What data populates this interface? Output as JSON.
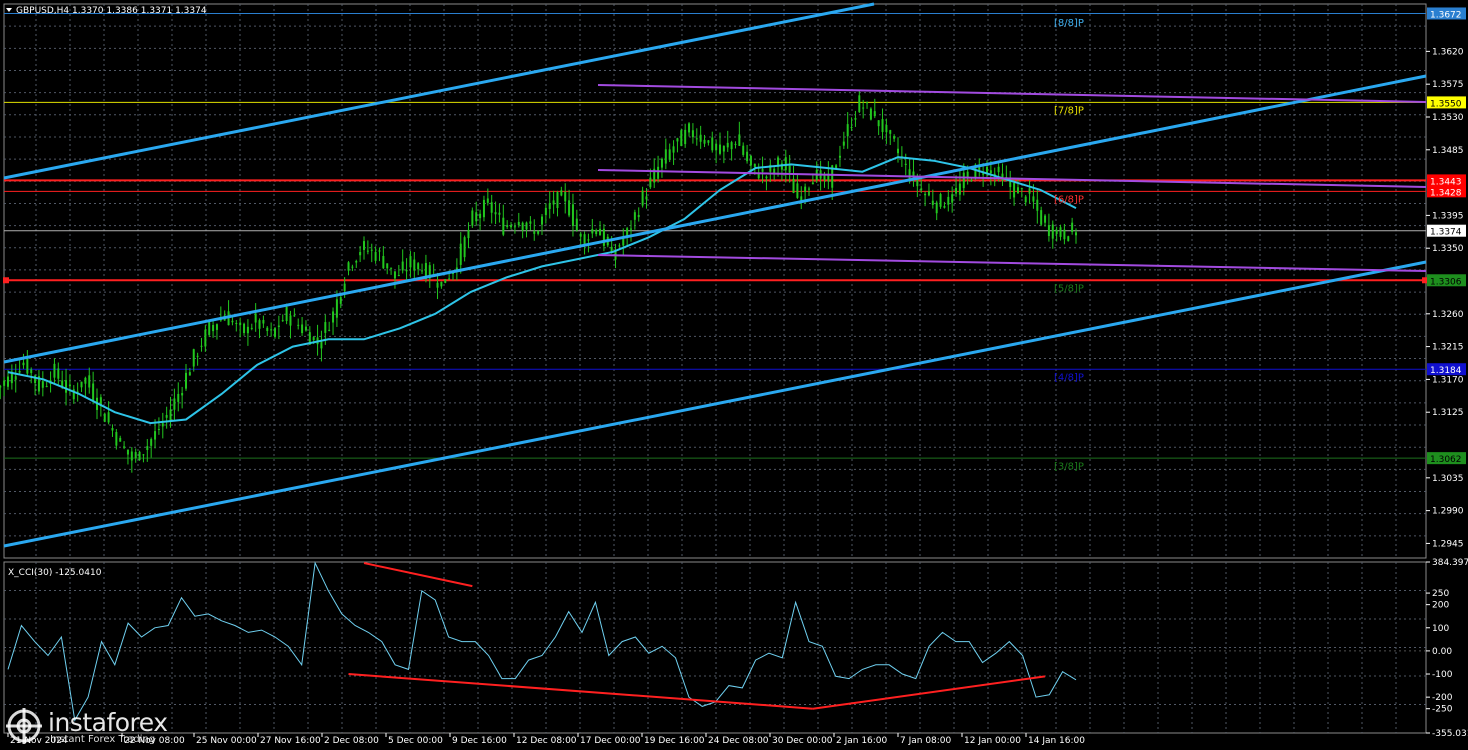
{
  "header": {
    "symbol_line": "GBPUSD,H4  1.3370 1.3386 1.3371 1.3374"
  },
  "indicator": {
    "label": "X_CCI(30) -125.0410"
  },
  "brand": {
    "name": "instaforex",
    "tagline": "Instant Forex Trading"
  },
  "colors": {
    "background": "#000000",
    "grid": "#5a6270",
    "candles": "#22c71f",
    "moving_average": "#2ec4e8",
    "channel": "#2aa8f0",
    "linreg": "#a24be0",
    "support_resistance": "#ff2020",
    "cci_line": "#6fd0f0",
    "divergence": "#ff2020",
    "axis_text": "#ffffff"
  },
  "chart_data": {
    "type": "candlestick",
    "price_axis": {
      "range": [
        1.2925,
        1.3685
      ],
      "ticks": [
        "1.3620",
        "1.3575",
        "1.3530",
        "1.3485",
        "1.3395",
        "1.3350",
        "1.3260",
        "1.3215",
        "1.3170",
        "1.3125",
        "1.3035",
        "1.2990",
        "1.2945"
      ]
    },
    "price_labels": [
      {
        "text": "1.3672",
        "value": 1.3672,
        "bg": "#2a7fd0",
        "fg": "#ffffff"
      },
      {
        "text": "1.3550",
        "value": 1.355,
        "bg": "#ffff00",
        "fg": "#000000"
      },
      {
        "text": "1.3443",
        "value": 1.3443,
        "bg": "#ff0000",
        "fg": "#ffffff"
      },
      {
        "text": "1.3428",
        "value": 1.3428,
        "bg": "#ff0000",
        "fg": "#ffffff"
      },
      {
        "text": "1.3374",
        "value": 1.3374,
        "bg": "#ffffff",
        "fg": "#000000"
      },
      {
        "text": "1.3306",
        "value": 1.3306,
        "bg": "#1e8f1e",
        "fg": "#000000"
      },
      {
        "text": "1.3184",
        "value": 1.3184,
        "bg": "#1010d0",
        "fg": "#ffffff"
      },
      {
        "text": "1.3062",
        "value": 1.3062,
        "bg": "#1e8f1e",
        "fg": "#000000"
      }
    ],
    "horizontal_lines": [
      {
        "value": 1.3672,
        "color": "#2a7fd0",
        "width": 1
      },
      {
        "value": 1.355,
        "color": "#e0e000",
        "width": 1
      },
      {
        "value": 1.3443,
        "color": "#ff2020",
        "width": 2
      },
      {
        "value": 1.3428,
        "color": "#ff2020",
        "width": 1
      },
      {
        "value": 1.3374,
        "color": "#b0b0b0",
        "width": 1
      },
      {
        "value": 1.3306,
        "color": "#ff2020",
        "width": 2
      },
      {
        "value": 1.3184,
        "color": "#1010d0",
        "width": 1
      },
      {
        "value": 1.3062,
        "color": "#1e6f1e",
        "width": 1
      }
    ],
    "murrey_labels": [
      {
        "text": "[8/8]P",
        "value": 1.366,
        "color": "#40b0f0"
      },
      {
        "text": "[7/8]P",
        "value": 1.354,
        "color": "#e8e000"
      },
      {
        "text": "[6/8]P",
        "value": 1.3418,
        "color": "#ff3030"
      },
      {
        "text": "[5/8]P",
        "value": 1.3296,
        "color": "#1a7a1a"
      },
      {
        "text": "[4/8]P",
        "value": 1.3174,
        "color": "#1010d0"
      },
      {
        "text": "[3/8]P",
        "value": 1.3052,
        "color": "#1a7a1a"
      }
    ],
    "time_labels": [
      "21 Nov 2024",
      "22 Nov 08:00",
      "25 Nov 00:00",
      "27 Nov 16:00",
      "2 Dec 08:00",
      "5 Dec 00:00",
      "9 Dec 16:00",
      "12 Dec 08:00",
      "17 Dec 00:00",
      "19 Dec 16:00",
      "24 Dec 08:00",
      "30 Dec 00:00",
      "2 Jan 16:00",
      "7 Jan 08:00",
      "12 Jan 00:00",
      "14 Jan 16:00"
    ],
    "closes": [
      1.317,
      1.3195,
      1.316,
      1.318,
      1.315,
      1.317,
      1.313,
      1.309,
      1.306,
      1.308,
      1.311,
      1.315,
      1.32,
      1.324,
      1.326,
      1.3235,
      1.325,
      1.323,
      1.326,
      1.324,
      1.322,
      1.326,
      1.333,
      1.335,
      1.334,
      1.331,
      1.333,
      1.332,
      1.33,
      1.333,
      1.339,
      1.341,
      1.338,
      1.339,
      1.337,
      1.341,
      1.342,
      1.336,
      1.338,
      1.334,
      1.337,
      1.342,
      1.346,
      1.349,
      1.351,
      1.35,
      1.348,
      1.35,
      1.346,
      1.345,
      1.347,
      1.342,
      1.345,
      1.344,
      1.35,
      1.355,
      1.353,
      1.35,
      1.346,
      1.343,
      1.341,
      1.342,
      1.345,
      1.346,
      1.345,
      1.343,
      1.342,
      1.338,
      1.337,
      1.3374
    ],
    "moving_average": [
      1.318,
      1.317,
      1.315,
      1.3125,
      1.311,
      1.3115,
      1.315,
      1.319,
      1.3215,
      1.3225,
      1.3225,
      1.324,
      1.326,
      1.329,
      1.331,
      1.3325,
      1.3335,
      1.3345,
      1.3365,
      1.339,
      1.343,
      1.346,
      1.3465,
      1.346,
      1.3455,
      1.3475,
      1.347,
      1.346,
      1.3445,
      1.343,
      1.3405
    ],
    "cci_axis": {
      "range": [
        -355.0316,
        384.3971
      ],
      "ticks": [
        {
          "text": "384.3971",
          "value": 384.3971
        },
        {
          "text": "250",
          "value": 250
        },
        {
          "text": "200",
          "value": 200
        },
        {
          "text": "100",
          "value": 100
        },
        {
          "text": "0.00",
          "value": 0
        },
        {
          "text": "-100",
          "value": -100
        },
        {
          "text": "-200",
          "value": -200
        },
        {
          "text": "-250",
          "value": -250
        },
        {
          "text": "-355.0316",
          "value": -355.0316
        }
      ]
    },
    "cci_values": [
      -80,
      110,
      40,
      -20,
      60,
      -300,
      -200,
      40,
      -60,
      120,
      60,
      100,
      110,
      230,
      150,
      160,
      130,
      110,
      80,
      90,
      60,
      20,
      -60,
      380,
      260,
      160,
      110,
      80,
      40,
      -60,
      -80,
      260,
      220,
      60,
      40,
      40,
      -20,
      -120,
      -120,
      -40,
      -20,
      60,
      170,
      80,
      210,
      -20,
      40,
      60,
      -10,
      20,
      -30,
      -200,
      -240,
      -220,
      -150,
      -160,
      -40,
      -10,
      -30,
      210,
      40,
      20,
      -110,
      -120,
      -80,
      -60,
      -60,
      -100,
      -120,
      20,
      80,
      40,
      40,
      -50,
      -10,
      40,
      -20,
      -200,
      -190,
      -90,
      -125
    ],
    "divergence_lines": [
      {
        "from": {
          "bar": 23,
          "cci": 380
        },
        "to": {
          "bar": 30,
          "cci": 280
        }
      },
      {
        "from": {
          "bar": 22,
          "cci": -100
        },
        "to": {
          "bar": 52,
          "cci": -250
        }
      },
      {
        "from": {
          "bar": 52,
          "cci": -250
        },
        "to": {
          "bar": 67,
          "cci": -110
        }
      }
    ]
  }
}
